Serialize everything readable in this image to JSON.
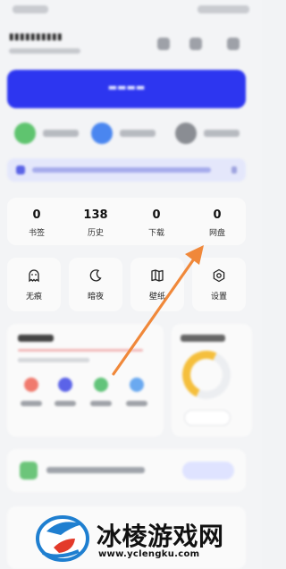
{
  "stats": [
    {
      "value": "0",
      "label": "书签"
    },
    {
      "value": "138",
      "label": "历史"
    },
    {
      "value": "0",
      "label": "下载"
    },
    {
      "value": "0",
      "label": "网盘"
    }
  ],
  "tools": [
    {
      "label": "无痕",
      "icon": "ghost-icon"
    },
    {
      "label": "暗夜",
      "icon": "moon-icon"
    },
    {
      "label": "壁纸",
      "icon": "book-icon"
    },
    {
      "label": "设置",
      "icon": "gear-icon"
    }
  ],
  "annotation": {
    "arrow_color": "#f0883a",
    "target": "网盘"
  },
  "watermark": {
    "title": "冰棱游戏网",
    "url": "www.yclengku.com"
  },
  "colors": {
    "accent": "#2d36f0",
    "background": "#f3f4f6"
  }
}
